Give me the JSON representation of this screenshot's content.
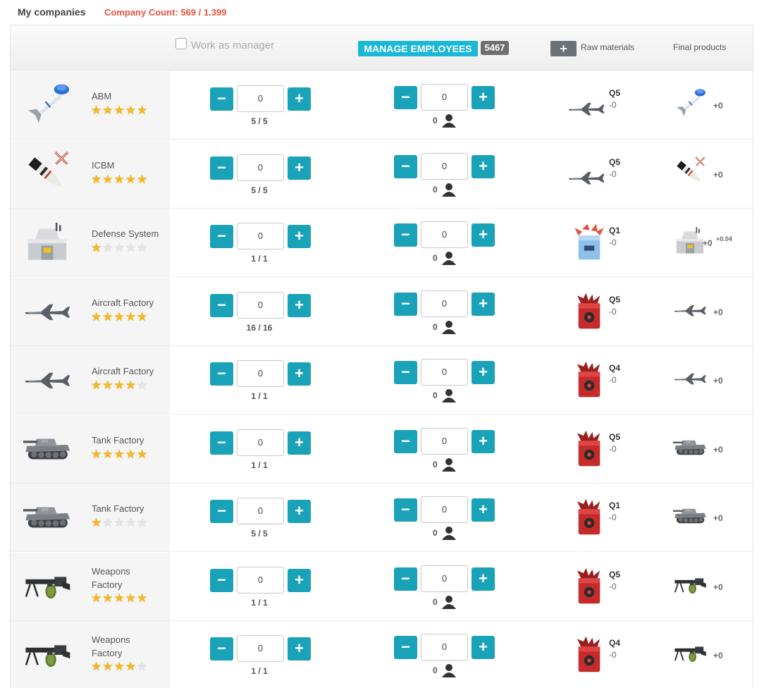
{
  "top": {
    "title": "My companies",
    "count_label": "Company Count: 569 / 1.399"
  },
  "header": {
    "work_as_manager": "Work as manager",
    "manage_employees": "MANAGE EMPLOYEES",
    "employee_total": "5467",
    "raw_plus": "+",
    "raw_materials": "Raw materials",
    "final_products": "Final products"
  },
  "rows": [
    {
      "name_l1": "ABM",
      "name_l2": "",
      "stars": 5,
      "icon": "abm-missile-icon",
      "mgr_value": "0",
      "ratio": "5 / 5",
      "emp_value": "0",
      "emp_count": "0",
      "raw_icon": "aircraft-icon",
      "quality": "Q5",
      "raw_delta": "-0",
      "final_icon": "abm-missile-icon",
      "final_delta": "+0",
      "final_extra": ""
    },
    {
      "name_l1": "ICBM",
      "name_l2": "",
      "stars": 5,
      "icon": "icbm-missile-icon",
      "mgr_value": "0",
      "ratio": "5 / 5",
      "emp_value": "0",
      "emp_count": "0",
      "raw_icon": "aircraft-icon",
      "quality": "Q5",
      "raw_delta": "-0",
      "final_icon": "icbm-missile-icon",
      "final_delta": "+0",
      "final_extra": ""
    },
    {
      "name_l1": "Defense System",
      "name_l2": "",
      "stars": 1,
      "icon": "defense-bunker-icon",
      "mgr_value": "0",
      "ratio": "1 / 1",
      "emp_value": "0",
      "emp_count": "0",
      "raw_icon": "blue-supply-box-icon",
      "quality": "Q1",
      "raw_delta": "-0",
      "final_icon": "defense-bunker-icon",
      "final_delta": "+0",
      "final_extra": "+0.04"
    },
    {
      "name_l1": "Aircraft Factory",
      "name_l2": "",
      "stars": 5,
      "icon": "aircraft-icon",
      "mgr_value": "0",
      "ratio": "16 / 16",
      "emp_value": "0",
      "emp_count": "0",
      "raw_icon": "red-supply-box-icon",
      "quality": "Q5",
      "raw_delta": "-0",
      "final_icon": "aircraft-icon",
      "final_delta": "+0",
      "final_extra": ""
    },
    {
      "name_l1": "Aircraft Factory",
      "name_l2": "",
      "stars": 4,
      "icon": "aircraft-icon",
      "mgr_value": "0",
      "ratio": "1 / 1",
      "emp_value": "0",
      "emp_count": "0",
      "raw_icon": "red-supply-box-icon",
      "quality": "Q4",
      "raw_delta": "-0",
      "final_icon": "aircraft-icon",
      "final_delta": "+0",
      "final_extra": ""
    },
    {
      "name_l1": "Tank Factory",
      "name_l2": "",
      "stars": 5,
      "icon": "tank-icon",
      "mgr_value": "0",
      "ratio": "1 / 1",
      "emp_value": "0",
      "emp_count": "0",
      "raw_icon": "red-supply-box-icon",
      "quality": "Q5",
      "raw_delta": "-0",
      "final_icon": "tank-icon",
      "final_delta": "+0",
      "final_extra": ""
    },
    {
      "name_l1": "Tank Factory",
      "name_l2": "",
      "stars": 1,
      "icon": "tank-icon",
      "mgr_value": "0",
      "ratio": "5 / 5",
      "emp_value": "0",
      "emp_count": "0",
      "raw_icon": "red-supply-box-icon",
      "quality": "Q1",
      "raw_delta": "-0",
      "final_icon": "tank-icon",
      "final_delta": "+0",
      "final_extra": ""
    },
    {
      "name_l1": "Weapons",
      "name_l2": "Factory",
      "stars": 5,
      "icon": "machine-gun-icon",
      "mgr_value": "0",
      "ratio": "1 / 1",
      "emp_value": "0",
      "emp_count": "0",
      "raw_icon": "red-supply-box-icon",
      "quality": "Q5",
      "raw_delta": "-0",
      "final_icon": "machine-gun-icon",
      "final_delta": "+0",
      "final_extra": ""
    },
    {
      "name_l1": "Weapons",
      "name_l2": "Factory",
      "stars": 4,
      "icon": "machine-gun-icon",
      "mgr_value": "0",
      "ratio": "1 / 1",
      "emp_value": "0",
      "emp_count": "0",
      "raw_icon": "red-supply-box-icon",
      "quality": "Q4",
      "raw_delta": "-0",
      "final_icon": "machine-gun-icon",
      "final_delta": "+0",
      "final_extra": ""
    }
  ],
  "stepper": {
    "minus": "−",
    "plus": "+"
  }
}
